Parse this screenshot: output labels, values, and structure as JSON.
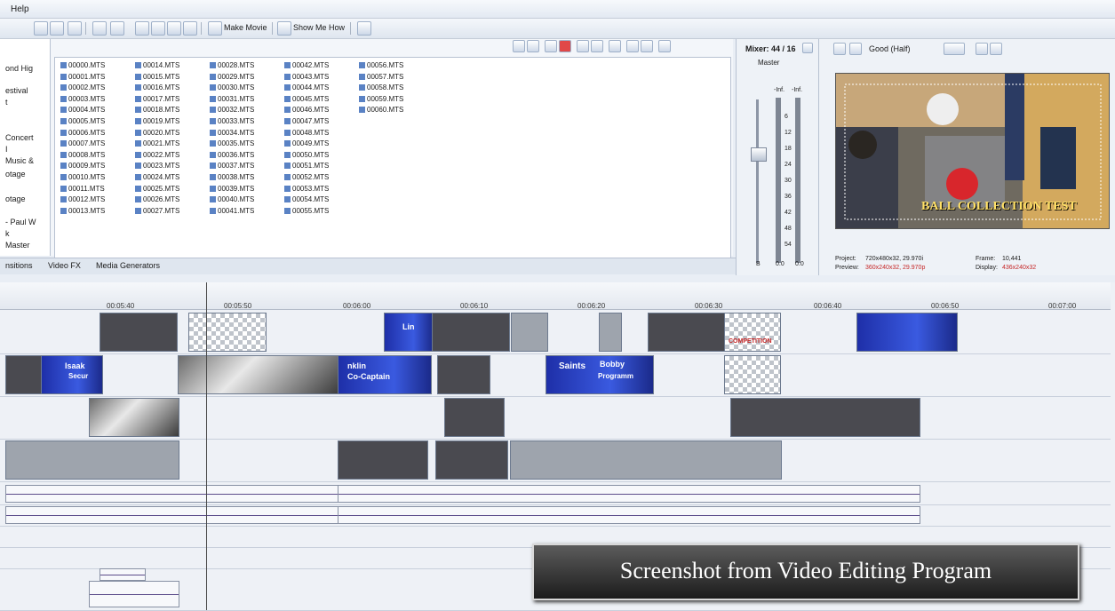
{
  "menu": {
    "help": "Help"
  },
  "toolbar": {
    "make_movie": "Make Movie",
    "show_me_how": "Show Me How"
  },
  "tree": {
    "items": [
      "ond Hig",
      "estival",
      "t",
      "Concert",
      "I",
      "Music &",
      "otage",
      "otage",
      "- Paul W",
      "k",
      "Master"
    ]
  },
  "files": {
    "col1": [
      "00000.MTS",
      "00001.MTS",
      "00002.MTS",
      "00003.MTS",
      "00004.MTS",
      "00005.MTS",
      "00006.MTS",
      "00007.MTS",
      "00008.MTS",
      "00009.MTS",
      "00010.MTS",
      "00011.MTS",
      "00012.MTS",
      "00013.MTS"
    ],
    "col2": [
      "00014.MTS",
      "00015.MTS",
      "00016.MTS",
      "00017.MTS",
      "00018.MTS",
      "00019.MTS",
      "00020.MTS",
      "00021.MTS",
      "00022.MTS",
      "00023.MTS",
      "00024.MTS",
      "00025.MTS",
      "00026.MTS",
      "00027.MTS"
    ],
    "col3": [
      "00028.MTS",
      "00029.MTS",
      "00030.MTS",
      "00031.MTS",
      "00032.MTS",
      "00033.MTS",
      "00034.MTS",
      "00035.MTS",
      "00036.MTS",
      "00037.MTS",
      "00038.MTS",
      "00039.MTS",
      "00040.MTS",
      "00041.MTS"
    ],
    "col4": [
      "00042.MTS",
      "00043.MTS",
      "00044.MTS",
      "00045.MTS",
      "00046.MTS",
      "00047.MTS",
      "00048.MTS",
      "00049.MTS",
      "00050.MTS",
      "00051.MTS",
      "00052.MTS",
      "00053.MTS",
      "00054.MTS",
      "00055.MTS"
    ],
    "col5": [
      "00056.MTS",
      "00057.MTS",
      "00058.MTS",
      "00059.MTS",
      "00060.MTS"
    ]
  },
  "tabs": {
    "transitions": "nsitions",
    "video_fx": "Video FX",
    "media_generators": "Media Generators"
  },
  "mixer": {
    "title": "Mixer: 44 / 16",
    "master": "Master",
    "inf_left": "-Inf.",
    "inf_right": "-Inf.",
    "scale": [
      "6",
      "12",
      "18",
      "24",
      "30",
      "36",
      "42",
      "48",
      "54"
    ],
    "bottom_left": "0.0",
    "bottom_right": "0.0",
    "bottom_icon": "B"
  },
  "preview": {
    "quality": "Good (Half)",
    "overlay_text": "BALL COLLECTION TEST",
    "project_label": "Project:",
    "project_value": "720x480x32, 29.970i",
    "preview_label": "Preview:",
    "preview_value": "360x240x32, 29.970p",
    "frame_label": "Frame:",
    "frame_value": "10,441",
    "display_label": "Display:",
    "display_value": "436x240x32"
  },
  "ruler": {
    "labels": [
      "00:05:40",
      "00:05:50",
      "00:06:00",
      "00:06:10",
      "00:06:20",
      "00:06:30",
      "00:06:40",
      "00:06:50",
      "00:07:00"
    ]
  },
  "clips": {
    "isaak_a": "Isaak",
    "isaak_b": "Secur",
    "franklin_a": "nklin",
    "franklin_b": "Co-Captain",
    "saints": "Saints",
    "bobby_a": "Bobby",
    "bobby_b": "Programm",
    "competition": "COMPETITION",
    "lin": "Lin"
  },
  "caption": "Screenshot from Video Editing Program"
}
